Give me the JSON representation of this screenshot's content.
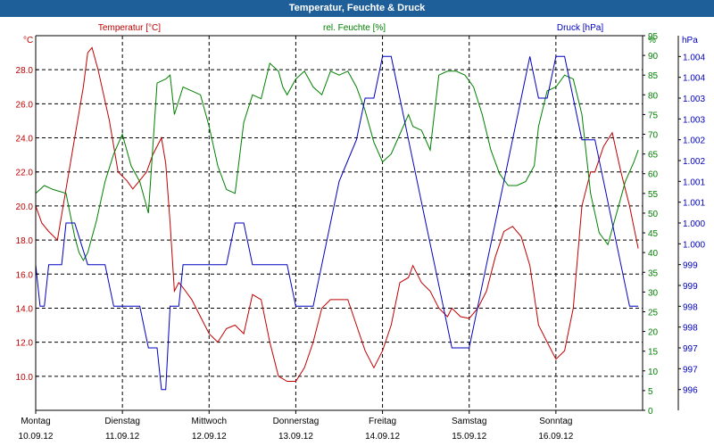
{
  "window": {
    "title": "Temperatur, Feuchte & Druck"
  },
  "colors": {
    "temperature": "#c00000",
    "humidity": "#008000",
    "pressure": "#0000c0",
    "titlebar": "#1f5f99"
  },
  "chart_data": {
    "type": "line",
    "title": "Temperatur, Feuchte & Druck",
    "grid": true,
    "x_axis": {
      "range": [
        0,
        7
      ],
      "ticks": [
        {
          "day": "Montag",
          "date": "10.09.12"
        },
        {
          "day": "Dienstag",
          "date": "11.09.12"
        },
        {
          "day": "Mittwoch",
          "date": "12.09.12"
        },
        {
          "day": "Donnerstag",
          "date": "13.09.12"
        },
        {
          "day": "Freitag",
          "date": "14.09.12"
        },
        {
          "day": "Samstag",
          "date": "15.09.12"
        },
        {
          "day": "Sonntag",
          "date": "16.09.12"
        }
      ]
    },
    "axes": {
      "temperature": {
        "label": "Temperatur [°C]",
        "unit": "°C",
        "range": [
          8.0,
          30.0
        ],
        "ticks": [
          "28.0",
          "26.0",
          "24.0",
          "22.0",
          "20.0",
          "18.0",
          "16.0",
          "14.0",
          "12.0",
          "10.0"
        ],
        "tick_values": [
          28,
          26,
          24,
          22,
          20,
          18,
          16,
          14,
          12,
          10
        ]
      },
      "humidity": {
        "label": "rel. Feuchte [%]",
        "unit": "%",
        "range": [
          0,
          95
        ],
        "ticks": [
          "0",
          "5",
          "10",
          "15",
          "20",
          "25",
          "30",
          "35",
          "40",
          "45",
          "50",
          "55",
          "60",
          "65",
          "70",
          "75",
          "80",
          "85",
          "90",
          "95"
        ],
        "tick_values": [
          0,
          5,
          10,
          15,
          20,
          25,
          30,
          35,
          40,
          45,
          50,
          55,
          60,
          65,
          70,
          75,
          80,
          85,
          90,
          95
        ]
      },
      "pressure": {
        "label": "Druck [hPa]",
        "unit": "hPa",
        "range": [
          995.5,
          1004.5
        ],
        "ticks": [
          "1.004",
          "1.004",
          "1.003",
          "1.003",
          "1.002",
          "1.002",
          "1.001",
          "1.001",
          "1.000",
          "1.000",
          "999",
          "999",
          "998",
          "998",
          "997",
          "997",
          "996"
        ],
        "tick_values": [
          1004.0,
          1003.5,
          1003.0,
          1002.5,
          1002.0,
          1001.5,
          1001.0,
          1000.5,
          1000.0,
          999.5,
          999.0,
          998.5,
          998.0,
          997.5,
          997.0,
          996.5,
          996.0
        ]
      }
    },
    "series": [
      {
        "name": "Temperatur [°C]",
        "axis": "temperature",
        "x": [
          0,
          0.07,
          0.15,
          0.25,
          0.35,
          0.45,
          0.55,
          0.6,
          0.65,
          0.72,
          0.85,
          0.95,
          1.05,
          1.12,
          1.2,
          1.28,
          1.35,
          1.45,
          1.5,
          1.55,
          1.6,
          1.65,
          1.7,
          1.8,
          1.9,
          2.0,
          2.1,
          2.2,
          2.3,
          2.4,
          2.5,
          2.6,
          2.7,
          2.8,
          2.9,
          3.0,
          3.1,
          3.2,
          3.3,
          3.4,
          3.5,
          3.6,
          3.7,
          3.8,
          3.9,
          4.0,
          4.1,
          4.2,
          4.3,
          4.35,
          4.45,
          4.55,
          4.65,
          4.75,
          4.8,
          4.9,
          5.0,
          5.1,
          5.2,
          5.3,
          5.4,
          5.5,
          5.6,
          5.7,
          5.8,
          5.9,
          6.0,
          6.1,
          6.2,
          6.3,
          6.4,
          6.45,
          6.55,
          6.65,
          6.75,
          6.85,
          6.95
        ],
        "values": [
          20.0,
          19.0,
          18.5,
          18.0,
          21.0,
          24.0,
          27.0,
          29.0,
          29.3,
          28.0,
          25.0,
          22.0,
          21.5,
          21.0,
          21.5,
          22.0,
          23.0,
          24.0,
          22.5,
          19.0,
          15.0,
          15.5,
          15.2,
          14.5,
          13.5,
          12.5,
          12.0,
          12.8,
          13.0,
          12.5,
          14.8,
          14.5,
          12.0,
          10.0,
          9.7,
          9.7,
          10.5,
          12.0,
          14.0,
          14.5,
          14.5,
          14.5,
          13.0,
          11.5,
          10.5,
          11.5,
          13.0,
          15.5,
          15.8,
          16.5,
          15.5,
          15.0,
          14.0,
          13.5,
          14.0,
          13.5,
          13.4,
          14.0,
          15.0,
          17.0,
          18.5,
          18.8,
          18.2,
          16.5,
          13.0,
          12.0,
          11.0,
          11.5,
          14.0,
          20.0,
          22.0,
          22.0,
          23.5,
          24.3,
          22.0,
          20.0,
          17.5
        ]
      },
      {
        "name": "rel. Feuchte [%]",
        "axis": "humidity",
        "x": [
          0,
          0.1,
          0.2,
          0.35,
          0.45,
          0.5,
          0.55,
          0.6,
          0.7,
          0.8,
          0.9,
          1.0,
          1.1,
          1.2,
          1.3,
          1.4,
          1.5,
          1.55,
          1.6,
          1.7,
          1.8,
          1.9,
          2.0,
          2.1,
          2.2,
          2.3,
          2.4,
          2.5,
          2.6,
          2.7,
          2.8,
          2.85,
          2.9,
          3.0,
          3.1,
          3.2,
          3.3,
          3.4,
          3.5,
          3.6,
          3.7,
          3.8,
          3.9,
          4.0,
          4.1,
          4.2,
          4.3,
          4.35,
          4.45,
          4.55,
          4.65,
          4.75,
          4.85,
          4.95,
          5.05,
          5.15,
          5.25,
          5.35,
          5.45,
          5.55,
          5.65,
          5.75,
          5.8,
          5.9,
          6.0,
          6.1,
          6.2,
          6.3,
          6.4,
          6.5,
          6.6,
          6.7,
          6.8,
          6.9,
          6.95
        ],
        "values": [
          55,
          57,
          56,
          55,
          44,
          40,
          38,
          40,
          48,
          58,
          65,
          70,
          62,
          58,
          50,
          83,
          84,
          85,
          75,
          82,
          81,
          80,
          72,
          62,
          56,
          55,
          73,
          80,
          79,
          88,
          86,
          82,
          80,
          84,
          86,
          82,
          80,
          86,
          85,
          86,
          82,
          76,
          68,
          63,
          65,
          70,
          75,
          72,
          71,
          66,
          85,
          86,
          86,
          85,
          82,
          75,
          66,
          60,
          57,
          57,
          58,
          62,
          72,
          81,
          82,
          85,
          84,
          75,
          55,
          45,
          42,
          50,
          58,
          63,
          66
        ]
      },
      {
        "name": "Druck [hPa]",
        "axis": "pressure",
        "x": [
          0,
          0.05,
          0.1,
          0.15,
          0.3,
          0.35,
          0.45,
          0.6,
          0.65,
          0.8,
          0.9,
          1.0,
          1.1,
          1.2,
          1.3,
          1.4,
          1.45,
          1.5,
          1.55,
          1.6,
          1.65,
          1.7,
          1.8,
          1.9,
          2.0,
          2.1,
          2.2,
          2.3,
          2.4,
          2.5,
          2.6,
          2.7,
          2.8,
          2.9,
          3.0,
          3.05,
          3.1,
          3.2,
          3.3,
          3.4,
          3.5,
          3.6,
          3.7,
          3.8,
          3.9,
          4.0,
          4.1,
          4.2,
          4.3,
          4.4,
          4.5,
          4.6,
          4.7,
          4.8,
          4.9,
          5.0,
          5.1,
          5.2,
          5.3,
          5.4,
          5.5,
          5.6,
          5.7,
          5.8,
          5.9,
          6.0,
          6.1,
          6.2,
          6.3,
          6.4,
          6.45,
          6.55,
          6.65,
          6.75,
          6.85,
          6.95
        ],
        "values": [
          999.0,
          998.0,
          998.0,
          999.0,
          999.0,
          1000.0,
          1000.0,
          999.0,
          999.0,
          999.0,
          998.0,
          998.0,
          998.0,
          998.0,
          997.0,
          997.0,
          996.0,
          996.0,
          998.0,
          998.0,
          998.0,
          999.0,
          999.0,
          999.0,
          999.0,
          999.0,
          999.0,
          1000.0,
          1000.0,
          999.0,
          999.0,
          999.0,
          999.0,
          999.0,
          998.0,
          998.0,
          998.0,
          998.0,
          999.0,
          1000.0,
          1001.0,
          1001.5,
          1002.0,
          1003.0,
          1003.0,
          1004.0,
          1004.0,
          1003.0,
          1002.0,
          1001.0,
          1000.0,
          999.0,
          998.0,
          997.0,
          997.0,
          997.0,
          998.0,
          999.0,
          1000.0,
          1001.0,
          1002.0,
          1003.0,
          1004.0,
          1003.0,
          1003.0,
          1004.0,
          1004.0,
          1003.0,
          1002.0,
          1002.0,
          1002.0,
          1001.0,
          1000.0,
          999.0,
          998.0,
          998.0
        ]
      }
    ]
  }
}
